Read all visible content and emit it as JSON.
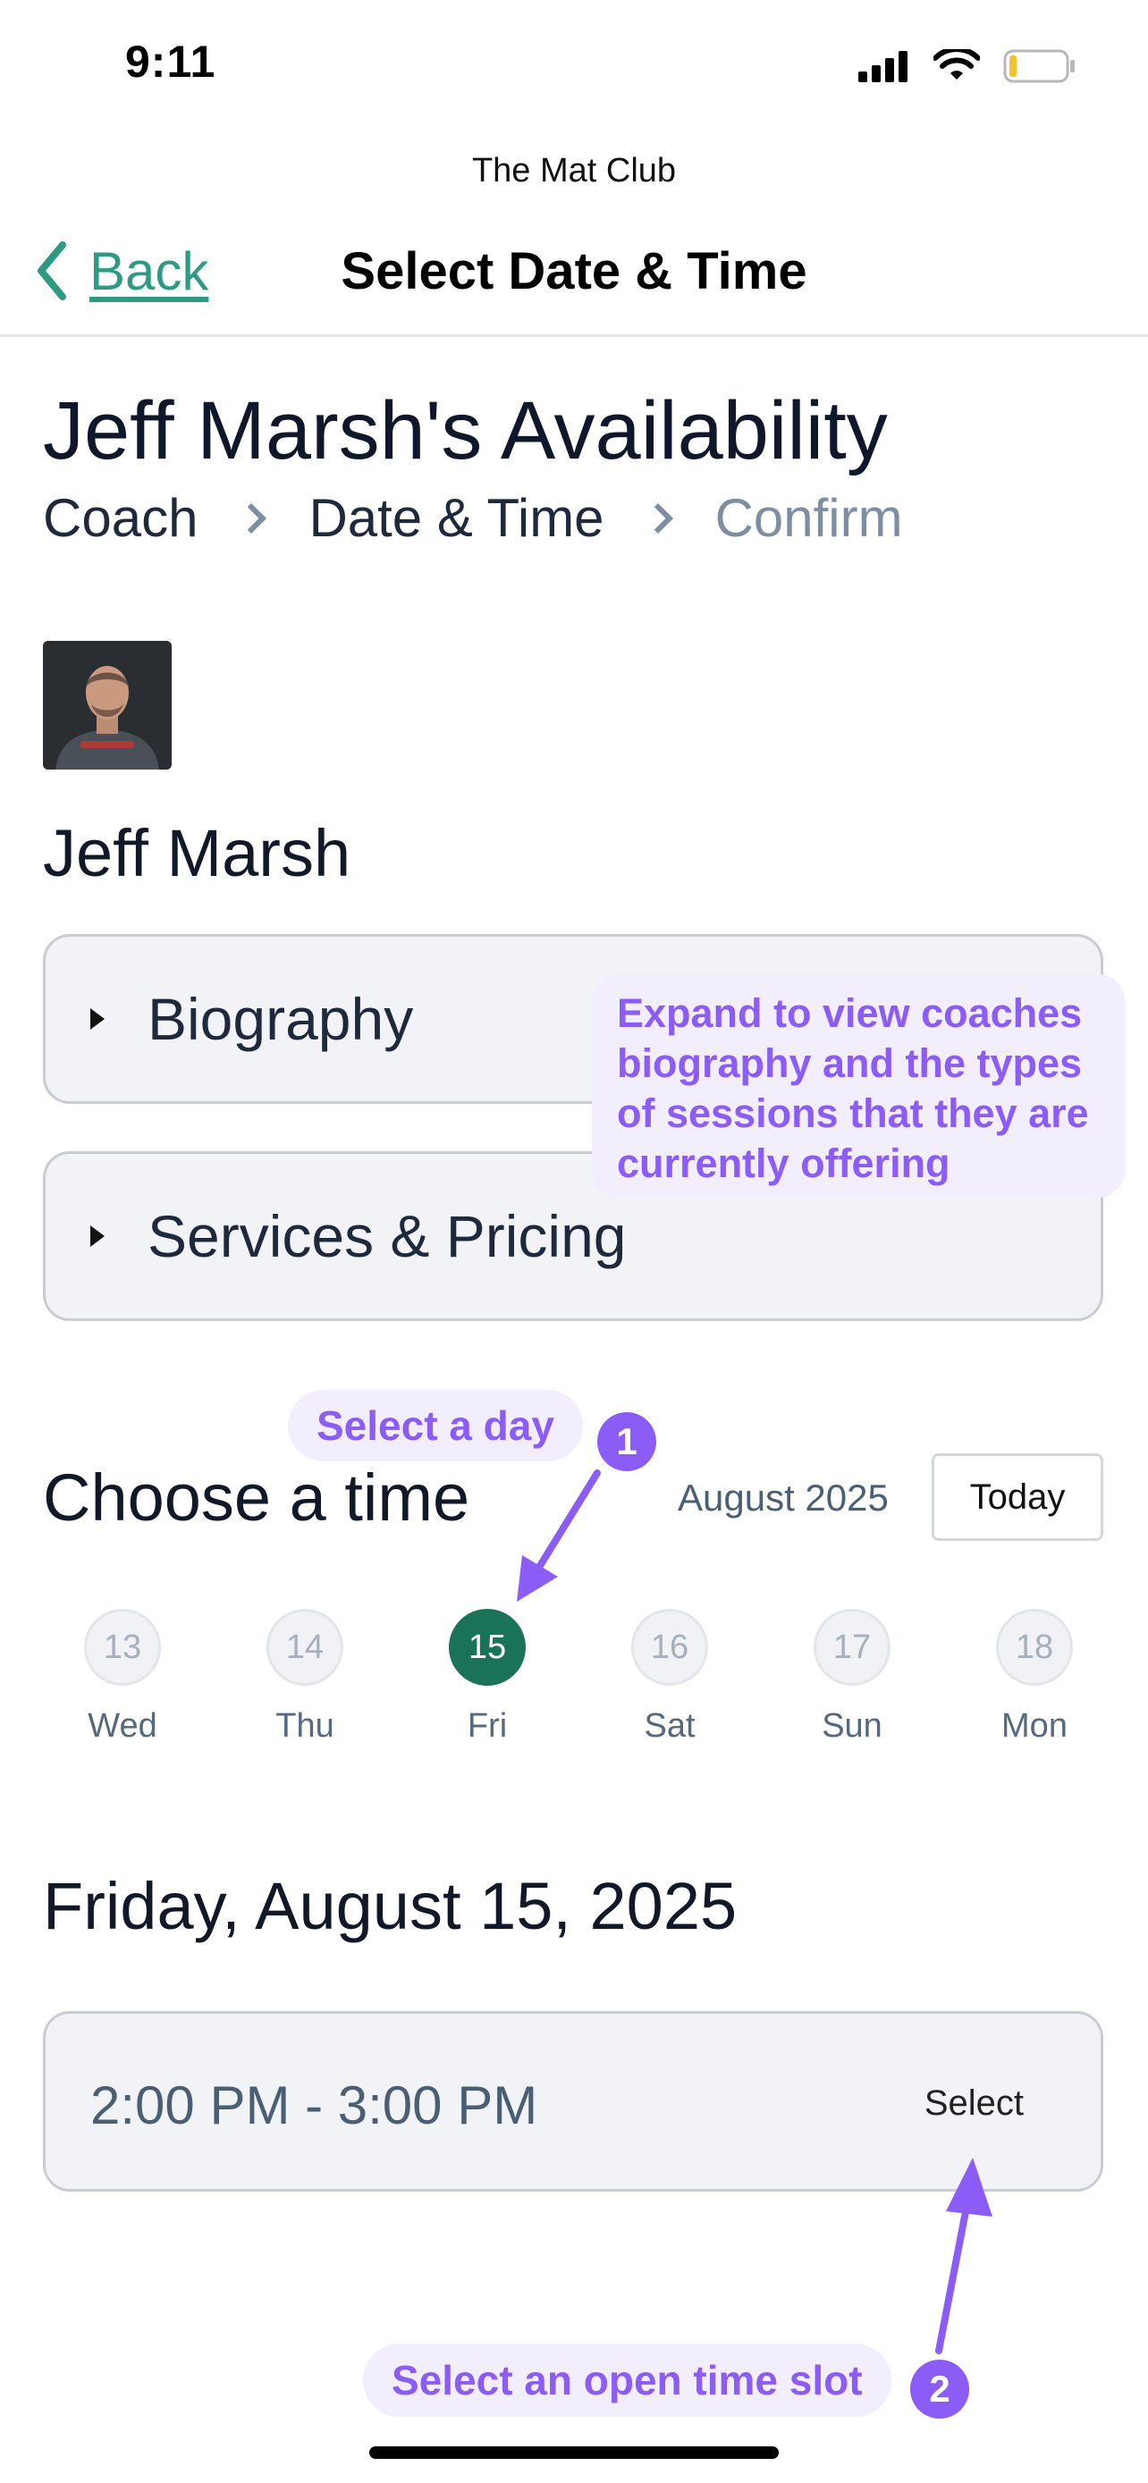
{
  "status_bar": {
    "time": "9:11"
  },
  "nav": {
    "app_name": "The Mat Club",
    "back_label": "Back",
    "title": "Select Date & Time"
  },
  "heading": {
    "title": "Jeff Marsh's Availability",
    "steps": [
      "Coach",
      "Date & Time",
      "Confirm"
    ]
  },
  "coach": {
    "name": "Jeff Marsh"
  },
  "accordions": [
    "Biography",
    "Services & Pricing"
  ],
  "callouts": {
    "expand": "Expand to view coaches biography and the types of sessions that they are currently offering",
    "select_day": "Select a day",
    "select_slot": "Select an open time slot",
    "num1": "1",
    "num2": "2"
  },
  "schedule": {
    "title": "Choose a time",
    "month": "August 2025",
    "today_label": "Today",
    "days": [
      {
        "num": "13",
        "name": "Wed",
        "selected": false
      },
      {
        "num": "14",
        "name": "Thu",
        "selected": false
      },
      {
        "num": "15",
        "name": "Fri",
        "selected": true
      },
      {
        "num": "16",
        "name": "Sat",
        "selected": false
      },
      {
        "num": "17",
        "name": "Sun",
        "selected": false
      },
      {
        "num": "18",
        "name": "Mon",
        "selected": false
      }
    ],
    "date_heading": "Friday, August 15, 2025",
    "slots": [
      {
        "time": "2:00 PM - 3:00 PM",
        "action": "Select"
      }
    ]
  },
  "colors": {
    "accent": "#2e9a82",
    "selected_day": "#1a7258",
    "callout": "#8b5cf6",
    "callout_bg": "#f3eefe"
  }
}
